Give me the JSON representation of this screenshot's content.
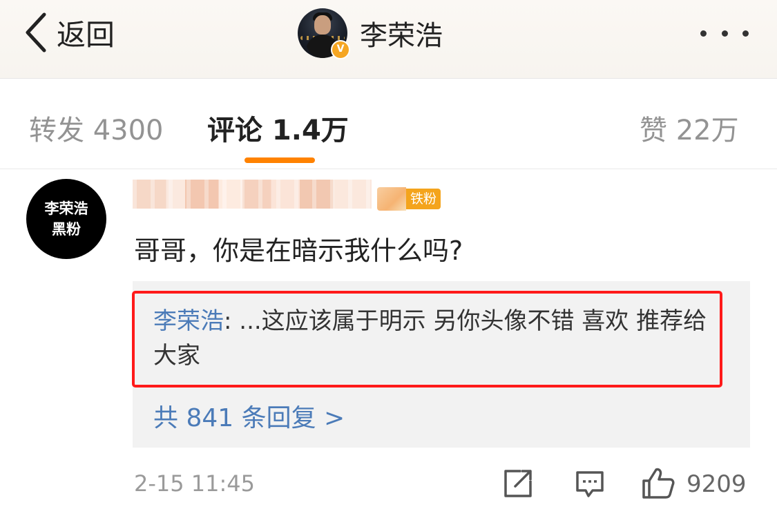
{
  "header": {
    "back_label": "返回",
    "title": "李荣浩",
    "verified_badge": "V"
  },
  "tabs": [
    {
      "label": "转发 4300"
    },
    {
      "label": "评论 1.4万"
    },
    {
      "label": "赞 22万"
    }
  ],
  "colors": {
    "accent": "#ff8200",
    "link": "#4b7bb8",
    "highlight": "#ff1a1a"
  },
  "comment": {
    "avatar_line1": "李荣浩",
    "avatar_line2": "黑粉",
    "fan_badge": "铁粉",
    "text": "哥哥，你是在暗示我什么吗?",
    "reply": {
      "author": "李荣浩",
      "content": ": ...这应该属于明示 另你头像不错 喜欢 推荐给大家"
    },
    "reply_count": "共 841 条回复 >",
    "timestamp": "2-15 11:45",
    "likes": "9209"
  }
}
